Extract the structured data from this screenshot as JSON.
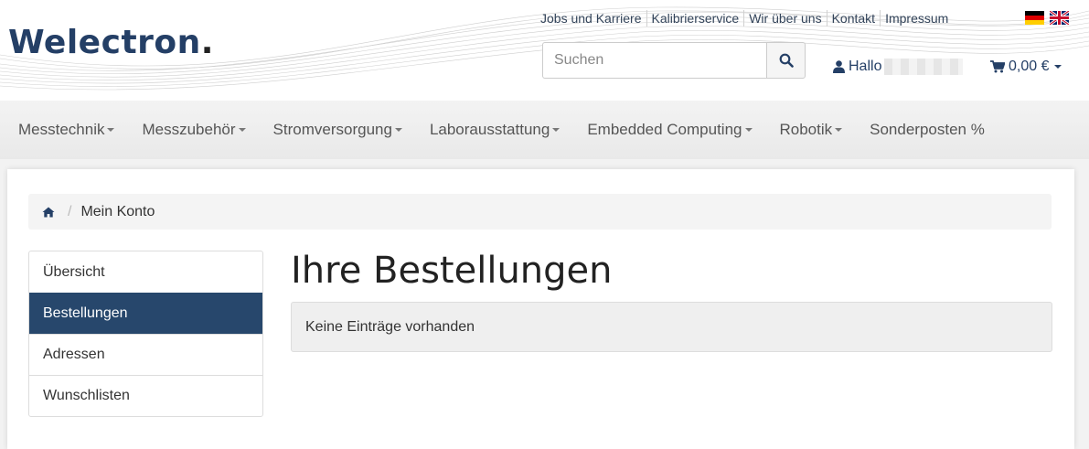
{
  "brand": {
    "name": "Welectron",
    "dot": ".",
    "color": "#243f66"
  },
  "top_links": [
    "Jobs und Karriere",
    "Kalibrierservice",
    "Wir über uns",
    "Kontakt",
    "Impressum"
  ],
  "languages": [
    {
      "icon": "flag-de-icon"
    },
    {
      "icon": "flag-gb-icon"
    }
  ],
  "search": {
    "placeholder": "Suchen",
    "value": "",
    "button_icon": "search-icon"
  },
  "account": {
    "greeting": "Hallo",
    "icon": "user-icon"
  },
  "cart": {
    "total": "0,00 €",
    "icon": "cart-icon"
  },
  "nav": [
    {
      "label": "Messtechnik",
      "dropdown": true
    },
    {
      "label": "Messzubehör",
      "dropdown": true
    },
    {
      "label": "Stromversorgung",
      "dropdown": true
    },
    {
      "label": "Laborausstattung",
      "dropdown": true
    },
    {
      "label": "Embedded Computing",
      "dropdown": true
    },
    {
      "label": "Robotik",
      "dropdown": true
    },
    {
      "label": "Sonderposten %",
      "dropdown": false
    }
  ],
  "breadcrumb": {
    "home_icon": "home-icon",
    "current": "Mein Konto"
  },
  "sidebar": {
    "items": [
      {
        "label": "Übersicht",
        "active": false
      },
      {
        "label": "Bestellungen",
        "active": true
      },
      {
        "label": "Adressen",
        "active": false
      },
      {
        "label": "Wunschlisten",
        "active": false
      }
    ],
    "active_color": "#27476c"
  },
  "main": {
    "title": "Ihre Bestellungen",
    "empty_message": "Keine Einträge vorhanden"
  }
}
